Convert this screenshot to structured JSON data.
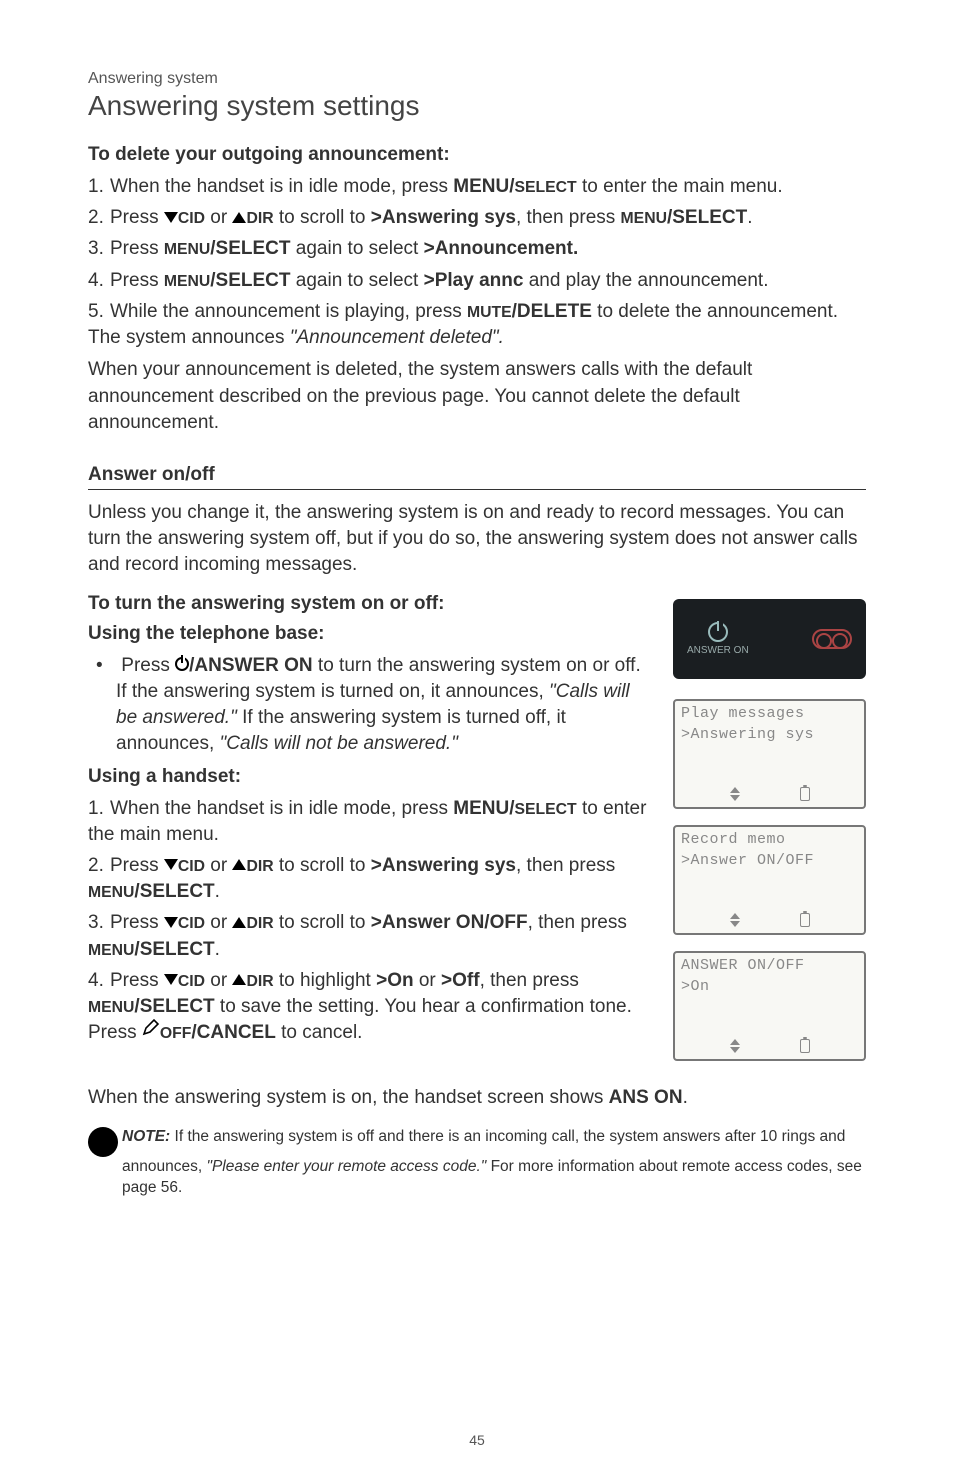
{
  "breadcrumb": "Answering system",
  "section_title": "Answering system settings",
  "h_delete": "To delete your outgoing announcement:",
  "steps_a": {
    "s1_a": "1.",
    "s1_b": "When the handset is in idle mode, press ",
    "s1_c": "MENU/",
    "s1_d": "SELECT",
    "s1_e": " to enter the main menu.",
    "s2_a": "2.",
    "s2_b": "Press ",
    "s2_c": "CID",
    "s2_d": " or ",
    "s2_e": "DIR",
    "s2_f": " to scroll to ",
    "s2_g": ">Answering sys",
    "s2_h": ", then press ",
    "s2_i": "MENU",
    "s2_j": "/SELECT",
    "s2_k": ".",
    "s3_a": "3.",
    "s3_b": "Press ",
    "s3_c": "MENU",
    "s3_d": "/SELECT",
    "s3_e": " again to select ",
    "s3_f": ">Announcement.",
    "s4_a": "4.",
    "s4_b": "Press ",
    "s4_c": "MENU",
    "s4_d": "/SELECT",
    "s4_e": " again to select ",
    "s4_f": ">Play annc",
    "s4_g": " and play the announcement.",
    "s5_a": "5.",
    "s5_b": "While the announcement is playing, press ",
    "s5_c": "MUTE",
    "s5_d": "/DELETE",
    "s5_e": " to delete the announcement. The system announces ",
    "s5_f": "\"Announcement deleted\".",
    "para_a": "When your announcement is deleted, the system answers calls with the default announcement described on the previous page. You cannot delete the default announcement."
  },
  "h_onoff": "Answer on/off",
  "para_b": "Unless you change it, the answering system is on and ready to record messages. You can turn the answering system off, but if you do so, the answering system does not answer calls and record incoming messages.",
  "h_turn": "To turn the answering system on or off:",
  "h_base": "Using the telephone base:",
  "bullet_base": {
    "b1": "Press ",
    "b2": "/ANSWER ON",
    "b3": " to turn the answering system on or off. If the answering system is turned on, it announces, ",
    "b4": "\"Calls will be answered.\"",
    "b5": " If the answering system is turned off, it announces, ",
    "b6": "\"Calls will not be answered.\""
  },
  "h_handset": "Using a handset:",
  "steps_b": {
    "s1_a": "1.",
    "s1_b": "When the handset is in idle mode, press ",
    "s1_c": "MENU/",
    "s1_d": "SELECT",
    "s1_e": " to enter the main menu.",
    "s2_a": "2.",
    "s2_b": "Press ",
    "s2_c": "CID",
    "s2_d": " or ",
    "s2_e": "DIR",
    "s2_f": " to scroll to ",
    "s2_g": ">Answering sys",
    "s2_h": ", then press ",
    "s2_i": "MENU",
    "s2_j": "/SELECT",
    "s2_k": ".",
    "s3_a": "3.",
    "s3_b": "Press ",
    "s3_c": "CID",
    "s3_d": " or ",
    "s3_e": "DIR",
    "s3_f": " to scroll to ",
    "s3_g": ">Answer ON/OFF",
    "s3_h": ", then press ",
    "s3_i": "MENU",
    "s3_j": "/SELECT",
    "s3_k": ".",
    "s4_a": "4.",
    "s4_b": "Press ",
    "s4_c": "CID",
    "s4_d": " or ",
    "s4_e": "DIR",
    "s4_f": " to highlight ",
    "s4_g": ">On",
    "s4_h": " or ",
    "s4_i": ">Off",
    "s4_j": ", then press ",
    "s4_k": "MENU",
    "s4_l": "/SELECT",
    "s4_m": " to save the setting. You hear a confirmation tone. Press ",
    "s4_n": "OFF",
    "s4_o": "/CANCEL",
    "s4_p": " to cancel."
  },
  "para_c_a": "When the answering system is on, the handset screen shows ",
  "para_c_b": "ANS ON",
  "para_c_c": ".",
  "note_label": "NOTE:",
  "note_body_a": " If the answering system is off and there is an incoming call, the system answers after 10 rings and announces, ",
  "note_body_b": "\"Please enter your remote access code.\"",
  "note_body_c": " For more information about remote access codes, see page 56.",
  "button": {
    "label": "ANSWER ON"
  },
  "lcd1": {
    "l1": " Play messages",
    "l2": ">Answering sys"
  },
  "lcd2": {
    "l1": " Record memo",
    "l2": ">Answer ON/OFF"
  },
  "lcd3": {
    "l1": " ANSWER ON/OFF",
    "l2": ">On"
  },
  "page_num": "45"
}
